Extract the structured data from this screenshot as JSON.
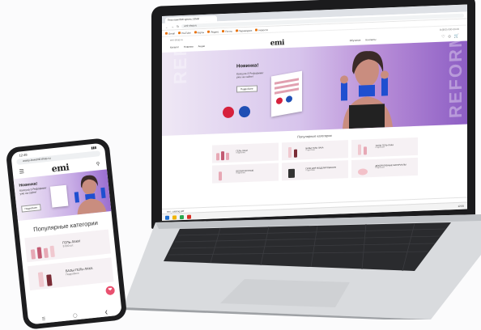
{
  "laptop": {
    "browser": {
      "tab_title": "Гель-лаки EMI купить | ЕМИ",
      "url": "emi-shop.ru",
      "bookmarks": [
        "Gmail",
        "YouTube",
        "Карты",
        "Яндекс",
        "Почта",
        "Переводчик",
        "Новости"
      ]
    },
    "site": {
      "top_left": "emi-shop.ru",
      "top_phone": "8 (800) 000-00-00",
      "logo": "emi",
      "menu": [
        "Каталог",
        "Новинки",
        "Акции",
        "Обучение",
        "Контакты"
      ],
      "hero": {
        "title": "Новинка!",
        "subtitle": "Капсула 3 Реформинг уже на сайте!",
        "button": "Подробнее",
        "vertical_word": "REFORMING"
      },
      "categories_title": "Популярные категории",
      "categories": [
        {
          "label": "Гель-лаки",
          "sub": "Подробнее"
        },
        {
          "label": "Базы гель-лака",
          "sub": "Подробнее"
        },
        {
          "label": "Топы гель-лака",
          "sub": "Подробнее"
        },
        {
          "label": "Бескислотные",
          "sub": "Подробнее"
        },
        {
          "label": "Гели для моделирования",
          "sub": "Подробнее"
        },
        {
          "label": "Декоративные материалы",
          "sub": "Подробнее"
        }
      ],
      "download_bar": "emi_catalog.pdf"
    },
    "taskbar_time": "12:00"
  },
  "phone": {
    "status_time": "12:48",
    "url": "eomy-boecmil.shop.ru",
    "logo": "emi",
    "hero": {
      "title": "Новинка!",
      "subtitle": "Капсула 3 Реформинг уже на сайте!",
      "button": "Подробнее"
    },
    "categories_title": "Популярные категории",
    "categories": [
      {
        "label": "Гель-лаки",
        "sub": "8 000 шт."
      },
      {
        "label": "Базы гель-лака",
        "sub": "Подробнее"
      }
    ]
  },
  "colors": {
    "accent": "#e9506f",
    "hero_purple": "#8d5ec4"
  }
}
